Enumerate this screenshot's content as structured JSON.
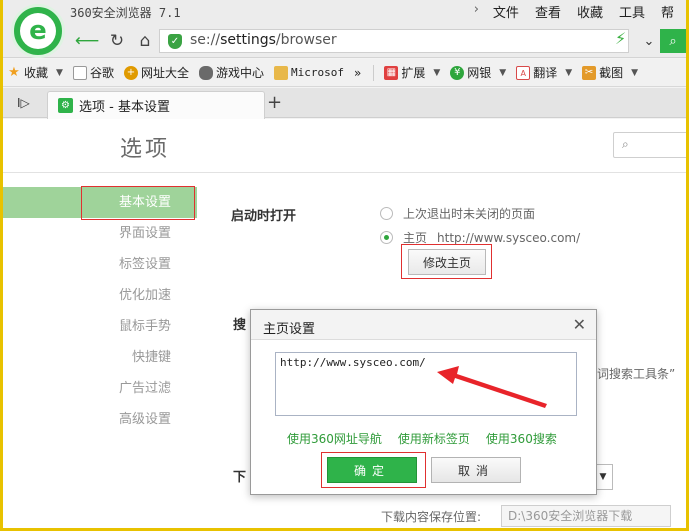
{
  "app": {
    "title": "360安全浏览器 7.1",
    "menu": [
      "文件",
      "查看",
      "收藏",
      "工具",
      "帮"
    ],
    "menu_arrow": "›"
  },
  "address": {
    "url_prefix": "se://",
    "url_host": "settings",
    "url_path": "/browser"
  },
  "bookmarks": [
    {
      "label": "收藏",
      "icon": "star-icon",
      "color": "#f0a020",
      "caret": true
    },
    {
      "label": "谷歌",
      "icon": "page-icon",
      "color": "#9a9a9a"
    },
    {
      "label": "网址大全",
      "icon": "nav-plus-icon",
      "color": "#e09a00"
    },
    {
      "label": "游戏中心",
      "icon": "gamepad-icon",
      "color": "#6a6a6a"
    },
    {
      "label": "Microsof",
      "icon": "folder-icon",
      "color": "#e8b84a"
    }
  ],
  "bookmarks_more": "»",
  "extensions": [
    {
      "label": "扩展",
      "icon": "grid-icon",
      "color": "#e04040"
    },
    {
      "label": "网银",
      "icon": "shield-yen-icon",
      "color": "#2fa63d"
    },
    {
      "label": "翻译",
      "icon": "translate-icon",
      "color": "#d84a4a"
    },
    {
      "label": "截图",
      "icon": "scissors-icon",
      "color": "#e39a2a"
    }
  ],
  "tab": {
    "label": "选项 - 基本设置"
  },
  "page": {
    "title": "选项",
    "nav": [
      "基本设置",
      "界面设置",
      "标签设置",
      "优化加速",
      "鼠标手势",
      "快捷键",
      "广告过滤",
      "高级设置"
    ],
    "startup": {
      "title": "启动时打开",
      "option1": "上次退出时未关闭的页面",
      "option2": "主页",
      "home_url": "http://www.sysceo.com/",
      "change_button": "修改主页"
    },
    "search_title_partial": "搜",
    "bg_search_text": "词搜索工具条”",
    "download_title_partial": "下",
    "download_location_label": "下载内容保存位置:",
    "download_location_value": "D:\\360安全浏览器下载"
  },
  "dialog": {
    "title": "主页设置",
    "textarea_value": "http://www.sysceo.com/",
    "links": [
      "使用360网址导航",
      "使用新标签页",
      "使用360搜索"
    ],
    "ok": "确定",
    "cancel": "取消"
  },
  "colors": {
    "brand_green": "#2fb34a",
    "nav_active_bg": "#9fd39a",
    "highlight_red": "#e03030",
    "outer_border": "#e8c200"
  }
}
